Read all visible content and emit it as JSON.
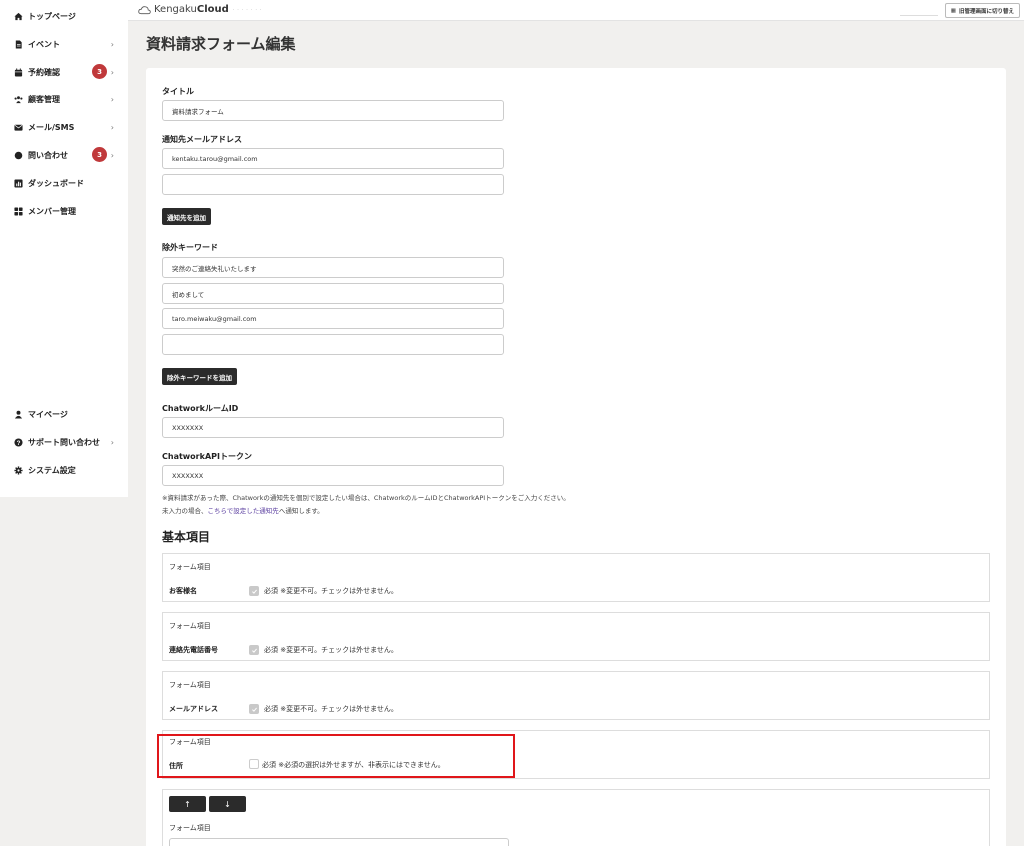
{
  "sidebar": {
    "top_items": [
      {
        "label": "トップページ",
        "icon": "home-icon",
        "chevron": false,
        "badge": ""
      },
      {
        "label": "イベント",
        "icon": "document-icon",
        "chevron": true,
        "badge": ""
      },
      {
        "label": "予約確認",
        "icon": "calendar-icon",
        "chevron": true,
        "badge": "3"
      },
      {
        "label": "顧客管理",
        "icon": "users-icon",
        "chevron": true,
        "badge": ""
      },
      {
        "label": "メール/SMS",
        "icon": "mail-icon",
        "chevron": true,
        "badge": ""
      },
      {
        "label": "問い合わせ",
        "icon": "chat-icon",
        "chevron": true,
        "badge": "3"
      },
      {
        "label": "ダッシュボード",
        "icon": "chart-icon",
        "chevron": false,
        "badge": ""
      },
      {
        "label": "メンバー管理",
        "icon": "grid-icon",
        "chevron": false,
        "badge": ""
      }
    ],
    "bottom_items": [
      {
        "label": "マイページ",
        "icon": "person-icon",
        "chevron": false
      },
      {
        "label": "サポート問い合わせ",
        "icon": "help-icon",
        "chevron": true
      },
      {
        "label": "システム設定",
        "icon": "gear-icon",
        "chevron": false
      }
    ]
  },
  "header": {
    "brand_light": "Kengaku",
    "brand_bold": "Cloud",
    "switch_label": "旧管理画面に切り替え"
  },
  "page": {
    "title": "資料請求フォーム編集"
  },
  "form": {
    "title_label": "タイトル",
    "title_value": "資料請求フォーム",
    "notify_label": "通知先メールアドレス",
    "notify_values": [
      "kentaku.tarou@gmail.com",
      ""
    ],
    "add_notify_button": "通知先を追加",
    "exclude_label": "除外キーワード",
    "exclude_values": [
      "突然のご連絡失礼いたします",
      "初めまして",
      "taro.meiwaku@gmail.com",
      ""
    ],
    "add_exclude_button": "除外キーワードを追加",
    "chatwork_room_label": "ChatworkルームID",
    "chatwork_room_value": "XXXXXXX",
    "chatwork_token_label": "ChatworkAPIトークン",
    "chatwork_token_value": "XXXXXXX",
    "note_line1": "※資料請求があった際、Chatworkの通知先を個別で設定したい場合は、ChatworkのルームIDとChatworkAPIトークンをご入力ください。",
    "note_line2_prefix": "未入力の場合、",
    "note_line2_link": "こちらで設定した通知先",
    "note_line2_suffix": "へ通知します。"
  },
  "basic_section": {
    "title": "基本項目",
    "items": [
      {
        "caption": "フォーム項目",
        "name": "お客様名",
        "checked": true,
        "note": "必須 ※変更不可。チェックは外せません。"
      },
      {
        "caption": "フォーム項目",
        "name": "連絡先電話番号",
        "checked": true,
        "note": "必須 ※変更不可。チェックは外せません。"
      },
      {
        "caption": "フォーム項目",
        "name": "メールアドレス",
        "checked": true,
        "note": "必須 ※変更不可。チェックは外せません。"
      },
      {
        "caption": "フォーム項目",
        "name": "住所",
        "checked": false,
        "note": "必須 ※必須の選択は外せますが、非表示にはできません。"
      }
    ],
    "last_item": {
      "up_label": "↑",
      "down_label": "↓",
      "caption": "フォーム項目"
    }
  },
  "colors": {
    "highlight": "#e0161a",
    "badge": "#c0393b",
    "dark_button": "#2b2b2b",
    "link": "#5b3fa0"
  }
}
